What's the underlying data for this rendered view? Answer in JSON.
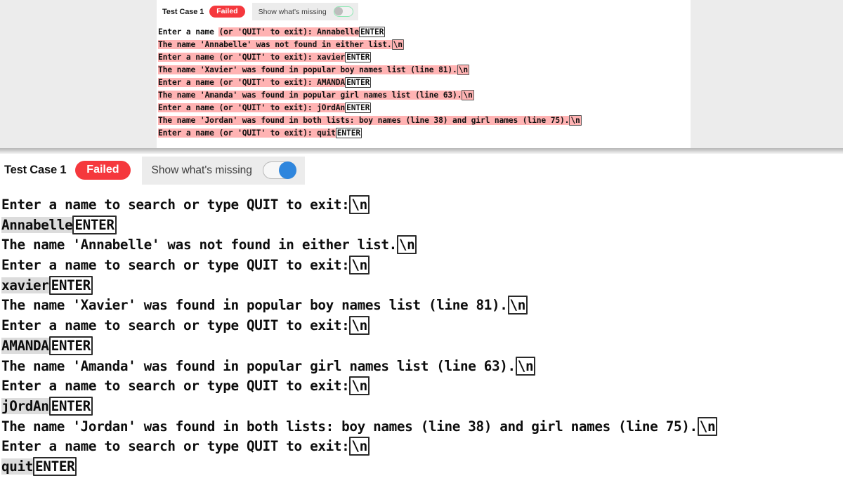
{
  "preview": {
    "title": "Test Case 1",
    "status_badge": "Failed",
    "toggle_label": "Show what's missing",
    "toggle_on": false,
    "badge_color": "#f5383d",
    "diff_highlight_color": "#ffb3b3",
    "lines": [
      [
        {
          "t": "Enter a name ",
          "h": false
        },
        {
          "t": "(or 'QUIT' to exit): Annabelle",
          "h": true
        },
        {
          "t": "ENTER",
          "k": true
        }
      ],
      [
        {
          "t": "The name 'Annabelle' was not found in either list.",
          "h": true
        },
        {
          "t": "\\n",
          "e": true
        }
      ],
      [
        {
          "t": "Enter a name (or 'QUIT' to exit): xavier",
          "h": true
        },
        {
          "t": "ENTER",
          "k": true
        }
      ],
      [
        {
          "t": "The name 'Xavier' was found in popular boy names list (line 81).",
          "h": true
        },
        {
          "t": "\\n",
          "e": true
        }
      ],
      [
        {
          "t": "Enter a name (or 'QUIT' to exit): AMANDA",
          "h": true
        },
        {
          "t": "ENTER",
          "k": true
        }
      ],
      [
        {
          "t": "The name 'Amanda' was found in popular girl names list (line 63).",
          "h": true
        },
        {
          "t": "\\n",
          "e": true
        }
      ],
      [
        {
          "t": "Enter a name (or 'QUIT' to exit): jOrdAn",
          "h": true
        },
        {
          "t": "ENTER",
          "k": true
        }
      ],
      [
        {
          "t": "The name 'Jordan' was found in both lists: boy names (line 38) and girl names (line 75).",
          "h": true
        },
        {
          "t": "\\n",
          "e": true
        }
      ],
      [
        {
          "t": "Enter a name (or 'QUIT' to exit): quit",
          "h": true
        },
        {
          "t": "ENTER",
          "k": true
        }
      ]
    ]
  },
  "main": {
    "title": "Test Case 1",
    "status_badge": "Failed",
    "toggle_label": "Show what's missing",
    "toggle_on": true,
    "badge_color": "#f5383d",
    "toggle_knob_color": "#2f86dd",
    "input_highlight_color": "#dcdcdc",
    "lines": [
      [
        {
          "t": "Enter a name to search or type QUIT to exit:"
        },
        {
          "t": "\\n",
          "e": true
        }
      ],
      [
        {
          "t": "Annabelle",
          "i": true
        },
        {
          "t": "ENTER",
          "k": true
        }
      ],
      [
        {
          "t": "The name 'Annabelle' was not found in either list."
        },
        {
          "t": "\\n",
          "e": true
        }
      ],
      [
        {
          "t": "Enter a name to search or type QUIT to exit:"
        },
        {
          "t": "\\n",
          "e": true
        }
      ],
      [
        {
          "t": "xavier",
          "i": true
        },
        {
          "t": "ENTER",
          "k": true
        }
      ],
      [
        {
          "t": "The name 'Xavier' was found in popular boy names list (line 81)."
        },
        {
          "t": "\\n",
          "e": true
        }
      ],
      [
        {
          "t": "Enter a name to search or type QUIT to exit:"
        },
        {
          "t": "\\n",
          "e": true
        }
      ],
      [
        {
          "t": "AMANDA",
          "i": true
        },
        {
          "t": "ENTER",
          "k": true
        }
      ],
      [
        {
          "t": "The name 'Amanda' was found in popular girl names list (line 63)."
        },
        {
          "t": "\\n",
          "e": true
        }
      ],
      [
        {
          "t": "Enter a name to search or type QUIT to exit:"
        },
        {
          "t": "\\n",
          "e": true
        }
      ],
      [
        {
          "t": "jOrdAn",
          "i": true
        },
        {
          "t": "ENTER",
          "k": true
        }
      ],
      [
        {
          "t": "The name 'Jordan' was found in both lists: boy names (line 38) and girl names (line 75)."
        },
        {
          "t": "\\n",
          "e": true
        }
      ],
      [
        {
          "t": "Enter a name to search or type QUIT to exit:"
        },
        {
          "t": "\\n",
          "e": true
        }
      ],
      [
        {
          "t": "quit",
          "i": true
        },
        {
          "t": "ENTER",
          "k": true
        }
      ]
    ]
  }
}
